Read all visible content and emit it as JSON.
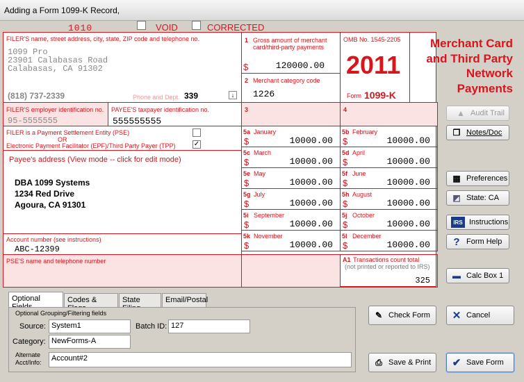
{
  "window": {
    "title": "Adding a Form 1099-K Record,"
  },
  "header": {
    "code": "1010",
    "void_label": "VOID",
    "corrected_label": "CORRECTED"
  },
  "filer": {
    "label": "FILER'S name, street address, city, state, ZIP code and telephone no.",
    "line1": "1099 Pro",
    "line2": "23901 Calabasas Road",
    "line3": "Calabasas, CA 91302",
    "phone": "(818) 737-2339",
    "phone_dept_label": "Phone and Dept.",
    "dept": "339"
  },
  "box1": {
    "num": "1",
    "label": "Gross amount of merchant card/third-party payments",
    "value": "120000.00"
  },
  "box2": {
    "num": "2",
    "label": "Merchant category code",
    "value": "1226"
  },
  "omb": {
    "label": "OMB No. 1545-2205",
    "year": "2011",
    "form_prefix": "Form",
    "form_name": "1099-K"
  },
  "form_title": "Merchant Card and Third Party Network Payments",
  "filer_ein": {
    "label": "FILER'S employer identification no.",
    "value": "95-5555555"
  },
  "payee_tin": {
    "label": "PAYEE'S taxpayer identification no.",
    "value": "555555555"
  },
  "box3": {
    "num": "3"
  },
  "box4": {
    "num": "4"
  },
  "pse": {
    "label": "FILER is a Payment Settlement Entity (PSE)",
    "or": "OR",
    "epf_label": "Electronic Payment Facilitator (EPF)/Third Party Payer (TPP)",
    "pse_checked": "",
    "epf_checked": "✓"
  },
  "payee": {
    "label": "Payee's address (View mode -- click for edit mode)",
    "line1": "DBA 1099 Systems",
    "line2": "1234 Red Drive",
    "line3": "Agoura, CA 91301"
  },
  "months": [
    {
      "num": "5a",
      "name": "January",
      "value": "10000.00"
    },
    {
      "num": "5b",
      "name": "February",
      "value": "10000.00"
    },
    {
      "num": "5c",
      "name": "March",
      "value": "10000.00"
    },
    {
      "num": "5d",
      "name": "April",
      "value": "10000.00"
    },
    {
      "num": "5e",
      "name": "May",
      "value": "10000.00"
    },
    {
      "num": "5f",
      "name": "June",
      "value": "10000.00"
    },
    {
      "num": "5g",
      "name": "July",
      "value": "10000.00"
    },
    {
      "num": "5h",
      "name": "August",
      "value": "10000.00"
    },
    {
      "num": "5i",
      "name": "September",
      "value": "10000.00"
    },
    {
      "num": "5j",
      "name": "October",
      "value": "10000.00"
    },
    {
      "num": "5k",
      "name": "November",
      "value": "10000.00"
    },
    {
      "num": "5l",
      "name": "December",
      "value": "10000.00"
    }
  ],
  "dollar": "$",
  "account": {
    "label": "Account number (see instructions)",
    "value": "ABC-12399"
  },
  "pse_name": {
    "label": "PSE'S name and telephone number"
  },
  "a1": {
    "num": "A1",
    "label": "Transactions count total",
    "sub": "(not printed or reported to IRS)",
    "value": "325"
  },
  "side_buttons": {
    "audit": "Audit Trail",
    "notes": "Notes/Doc",
    "prefs": "Preferences",
    "state": "State: CA",
    "instructions": "Instructions",
    "help": "Form Help",
    "calc": "Calc Box 1"
  },
  "tabs": [
    "Optional Fields",
    "Codes & Flags",
    "State Filing",
    "Email/Postal"
  ],
  "optional": {
    "group_label": "Optional Grouping/Filtering fields",
    "source_label": "Source:",
    "source": "System1",
    "batch_label": "Batch ID:",
    "batch": "127",
    "category_label": "Category:",
    "category": "NewForms-A",
    "alt_label1": "Alternate",
    "alt_label2": "Acct/Info:",
    "alt": "Account#2"
  },
  "bottom_buttons": {
    "check": "Check Form",
    "cancel": "Cancel",
    "print": "Save & Print",
    "save": "Save Form"
  },
  "colors": {
    "accent": "#d8141c",
    "pink": "#fbe3e3"
  }
}
